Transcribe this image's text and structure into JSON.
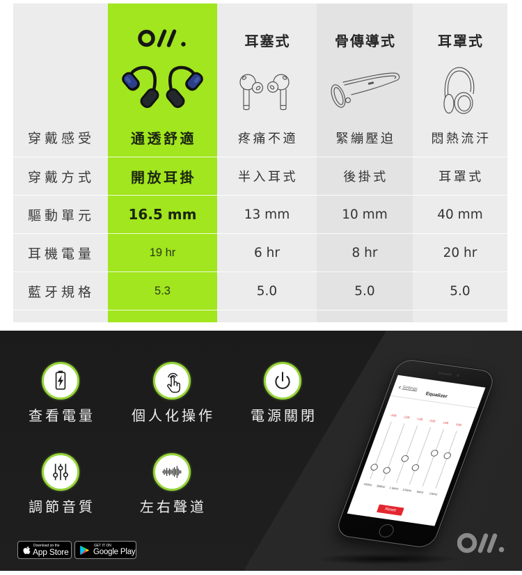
{
  "table": {
    "headers": [
      {
        "title": ""
      },
      {
        "title": "",
        "logo_icon": "brand-logo",
        "product_icon": "open-ear-earbuds-icon"
      },
      {
        "title": "耳塞式",
        "product_icon": "in-ear-earbuds-icon"
      },
      {
        "title": "骨傳導式",
        "product_icon": "bone-conduction-headphones-icon"
      },
      {
        "title": "耳罩式",
        "product_icon": "over-ear-headphones-icon"
      }
    ],
    "rows": [
      {
        "label": "穿戴感受",
        "values": [
          "通透舒適",
          "疼痛不適",
          "緊繃壓迫",
          "悶熱流汗"
        ]
      },
      {
        "label": "穿戴方式",
        "values": [
          "開放耳掛",
          "半入耳式",
          "後掛式",
          "耳罩式"
        ]
      },
      {
        "label": "驅動單元",
        "values": [
          "16.5 mm",
          "13 mm",
          "10 mm",
          "40 mm"
        ]
      },
      {
        "label": "耳機電量",
        "values": [
          "19 hr",
          "6 hr",
          "8 hr",
          "20 hr"
        ]
      },
      {
        "label": "藍牙規格",
        "values": [
          "5.3",
          "5.0",
          "5.0",
          "5.0"
        ]
      }
    ]
  },
  "features": [
    {
      "label": "查看電量",
      "icon": "battery-charging-icon"
    },
    {
      "label": "個人化操作",
      "icon": "tap-gesture-icon"
    },
    {
      "label": "電源關閉",
      "icon": "power-icon"
    },
    {
      "label": "調節音質",
      "icon": "equalizer-sliders-icon"
    },
    {
      "label": "左右聲道",
      "icon": "sound-wave-icon"
    }
  ],
  "store_badges": {
    "app_store": {
      "small": "Download on the",
      "large": "App Store",
      "icon": "apple-icon"
    },
    "google_play": {
      "small": "GET IT ON",
      "large": "Google Play",
      "icon": "google-play-icon"
    }
  },
  "phone": {
    "back_label": "Settings",
    "title": "Equalizer",
    "bands": [
      {
        "gain": "-3dB",
        "freq": "150Hz",
        "level": 0.2
      },
      {
        "gain": "-2dB",
        "freq": "500Hz",
        "level": 0.18
      },
      {
        "gain": "-1dB",
        "freq": "1.5kHz",
        "level": 0.42
      },
      {
        "gain": "0dB",
        "freq": "3.5kHz",
        "level": 0.3
      },
      {
        "gain": "1dB",
        "freq": "5kHz",
        "level": 0.58
      },
      {
        "gain": "3dB",
        "freq": "12kHz",
        "level": 0.57
      }
    ],
    "reset_label": "Reset"
  },
  "footer_logo_icon": "brand-logo",
  "colors": {
    "accent_green": "#a1e61e",
    "icon_ring_green": "#96d63a",
    "table_bg": "#ececec",
    "bone_column_bg": "#e3e3e3",
    "reset_red": "#e3262e",
    "gain_label_red": "#e05a5a",
    "footer_logo_gray": "#8a8a8a"
  }
}
